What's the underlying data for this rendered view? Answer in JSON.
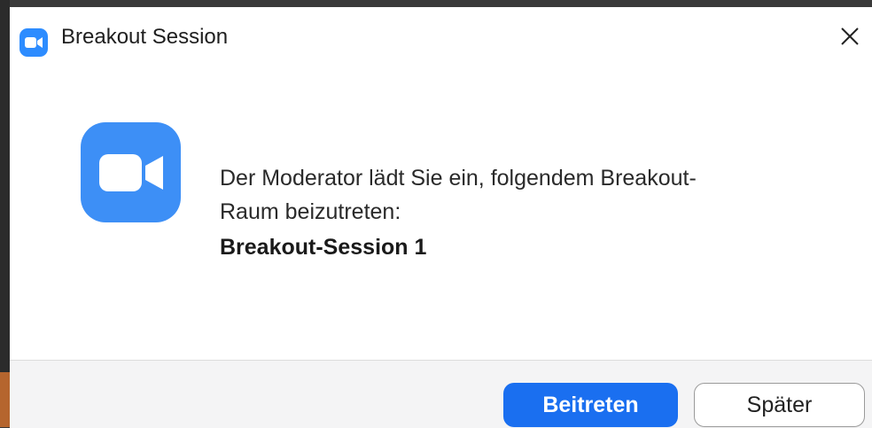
{
  "window": {
    "title": "Breakout Session"
  },
  "icons": {
    "app": "zoom-camera-icon",
    "close": "close-icon",
    "logo": "zoom-logo-icon"
  },
  "dialog": {
    "message_line1": "Der Moderator lädt Sie ein, folgendem Breakout-",
    "message_line2": "Raum beizutreten:",
    "room_name": "Breakout-Session 1"
  },
  "buttons": {
    "join": "Beitreten",
    "later": "Später"
  },
  "colors": {
    "brand_blue": "#2d8cff",
    "primary_button": "#1a6ff0"
  }
}
